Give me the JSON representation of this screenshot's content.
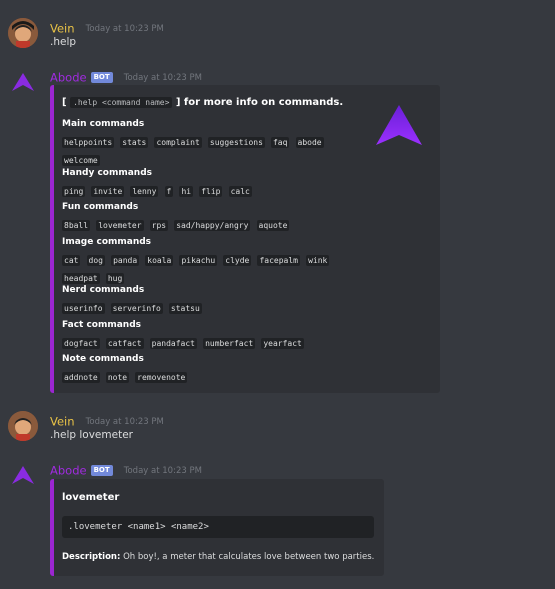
{
  "messages": [
    {
      "author": "Vein",
      "timestamp": "Today at 10:23 PM",
      "content": ".help"
    },
    {
      "author": "Abode",
      "bot_tag": "BOT",
      "timestamp": "Today at 10:23 PM"
    },
    {
      "author": "Vein",
      "timestamp": "Today at 10:23 PM",
      "content": ".help lovemeter"
    },
    {
      "author": "Abode",
      "bot_tag": "BOT",
      "timestamp": "Today at 10:23 PM"
    }
  ],
  "help_embed": {
    "title_prefix": "[",
    "title_code": ".help <command name>",
    "title_suffix": "] for more info on commands.",
    "fields": [
      {
        "name": "Main commands",
        "values": [
          "helppoints",
          "stats",
          "complaint",
          "suggestions",
          "faq",
          "abode",
          "welcome"
        ]
      },
      {
        "name": "Handy commands",
        "values": [
          "ping",
          "invite",
          "lenny",
          "f",
          "hi",
          "flip",
          "calc"
        ]
      },
      {
        "name": "Fun commands",
        "values": [
          "8ball",
          "lovemeter",
          "rps",
          "sad/happy/angry",
          "aquote"
        ]
      },
      {
        "name": "Image commands",
        "values": [
          "cat",
          "dog",
          "panda",
          "koala",
          "pikachu",
          "clyde",
          "facepalm",
          "wink",
          "headpat",
          "hug"
        ]
      },
      {
        "name": "Nerd commands",
        "values": [
          "userinfo",
          "serverinfo",
          "statsu"
        ]
      },
      {
        "name": "Fact commands",
        "values": [
          "dogfact",
          "catfact",
          "pandafact",
          "numberfact",
          "yearfact"
        ]
      },
      {
        "name": "Note commands",
        "values": [
          "addnote",
          "note",
          "removenote"
        ]
      }
    ]
  },
  "lovemeter_embed": {
    "title": "lovemeter",
    "usage": ".lovemeter <name1> <name2>",
    "description_label": "Description:",
    "description": "Oh boy!, a meter that calculates love between two parties."
  },
  "colors": {
    "background": "#36393f",
    "embed_background": "#2f3136",
    "embed_border": "#9b26d1",
    "user_name": "#e8c247",
    "bot_name": "#a02be0",
    "bot_tag": "#7289da"
  },
  "icons": {
    "user_avatar": "avatar-icon",
    "bot_avatar": "abode-logo-icon",
    "embed_thumbnail": "abode-logo-icon"
  }
}
